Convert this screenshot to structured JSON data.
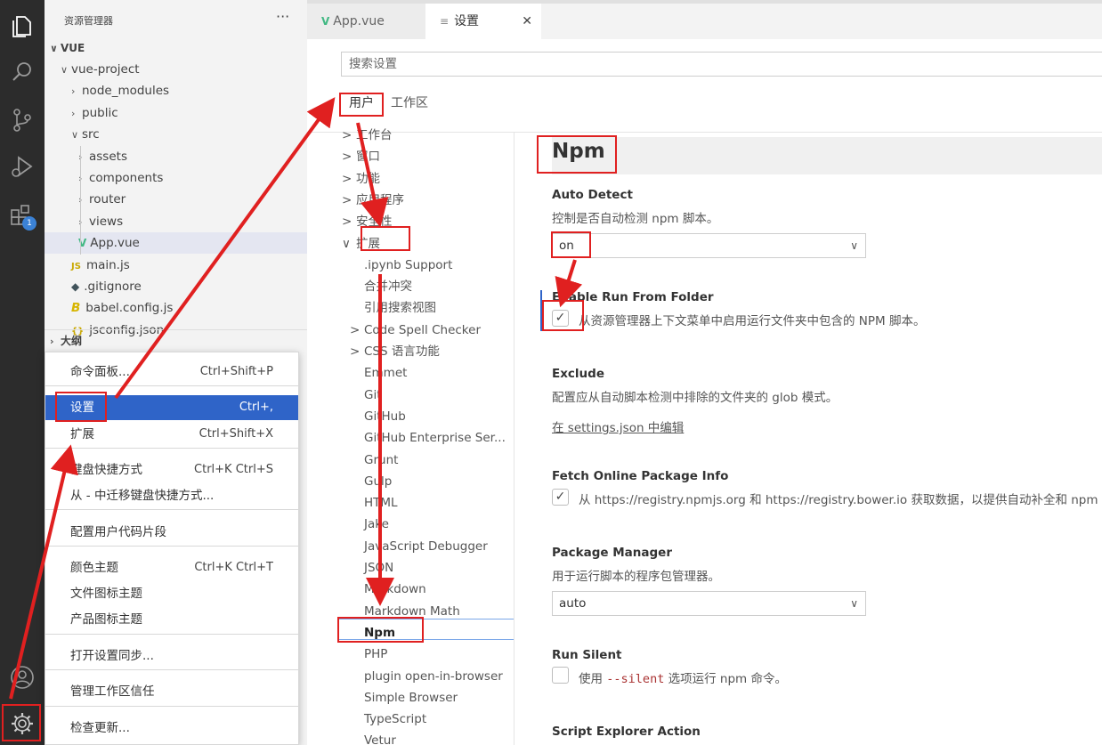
{
  "sidebar": {
    "title": "资源管理器",
    "more": "···",
    "root": "VUE",
    "tree": [
      {
        "label": "vue-project",
        "kind": "folder-open"
      },
      {
        "label": "node_modules",
        "kind": "folder"
      },
      {
        "label": "public",
        "kind": "folder"
      },
      {
        "label": "src",
        "kind": "folder-open"
      },
      {
        "label": "assets",
        "kind": "folder"
      },
      {
        "label": "components",
        "kind": "folder"
      },
      {
        "label": "router",
        "kind": "folder"
      },
      {
        "label": "views",
        "kind": "folder"
      },
      {
        "label": "App.vue",
        "kind": "vue"
      },
      {
        "label": "main.js",
        "kind": "js"
      },
      {
        "label": ".gitignore",
        "kind": "git"
      },
      {
        "label": "babel.config.js",
        "kind": "babel"
      },
      {
        "label": "jsconfig.json",
        "kind": "json"
      }
    ],
    "outline": "大纲",
    "extensions_badge": "1",
    "icons": {
      "vue": "V",
      "js": "JS",
      "git": "◆",
      "babel": "B",
      "json": "{}"
    }
  },
  "menu": {
    "items": [
      {
        "label": "命令面板...",
        "key": "Ctrl+Shift+P"
      },
      {
        "label": "设置",
        "key": "Ctrl+,"
      },
      {
        "label": "扩展",
        "key": "Ctrl+Shift+X"
      },
      {
        "label": "键盘快捷方式",
        "key": "Ctrl+K Ctrl+S"
      },
      {
        "label": "从 - 中迁移键盘快捷方式...",
        "key": ""
      },
      {
        "label": "配置用户代码片段",
        "key": ""
      },
      {
        "label": "颜色主题",
        "key": "Ctrl+K Ctrl+T"
      },
      {
        "label": "文件图标主题",
        "key": ""
      },
      {
        "label": "产品图标主题",
        "key": ""
      },
      {
        "label": "打开设置同步...",
        "key": ""
      },
      {
        "label": "管理工作区信任",
        "key": ""
      },
      {
        "label": "检查更新...",
        "key": ""
      }
    ]
  },
  "tabs": [
    {
      "label": "App.vue",
      "icon": "V"
    },
    {
      "label": "设置",
      "icon": "≡",
      "close": "✕"
    }
  ],
  "settings": {
    "search_placeholder": "搜索设置",
    "scopes": [
      "用户",
      "工作区"
    ],
    "toc": [
      {
        "label": "工作台",
        "chev": ">"
      },
      {
        "label": "窗口",
        "chev": ">"
      },
      {
        "label": "功能",
        "chev": ">"
      },
      {
        "label": "应用程序",
        "chev": ">"
      },
      {
        "label": "安全性",
        "chev": ">"
      },
      {
        "label": "扩展",
        "chev": "∨"
      },
      {
        "label": ".ipynb Support",
        "chev": ""
      },
      {
        "label": "合并冲突",
        "chev": ""
      },
      {
        "label": "引用搜索视图",
        "chev": ""
      },
      {
        "label": "Code Spell Checker",
        "chev": ">"
      },
      {
        "label": "CSS 语言功能",
        "chev": ">"
      },
      {
        "label": "Emmet",
        "chev": ""
      },
      {
        "label": "Git",
        "chev": ""
      },
      {
        "label": "GitHub",
        "chev": ""
      },
      {
        "label": "GitHub Enterprise Ser...",
        "chev": ""
      },
      {
        "label": "Grunt",
        "chev": ""
      },
      {
        "label": "Gulp",
        "chev": ""
      },
      {
        "label": "HTML",
        "chev": ""
      },
      {
        "label": "Jake",
        "chev": ""
      },
      {
        "label": "JavaScript Debugger",
        "chev": ""
      },
      {
        "label": "JSON",
        "chev": ""
      },
      {
        "label": "Markdown",
        "chev": ""
      },
      {
        "label": "Markdown Math",
        "chev": ""
      },
      {
        "label": "Npm",
        "chev": ""
      },
      {
        "label": "PHP",
        "chev": ""
      },
      {
        "label": "plugin open-in-browser",
        "chev": ""
      },
      {
        "label": "Simple Browser",
        "chev": ""
      },
      {
        "label": "TypeScript",
        "chev": ""
      },
      {
        "label": "Vetur",
        "chev": ""
      }
    ],
    "heading": "Npm",
    "auto_detect": {
      "title": "Auto Detect",
      "desc": "控制是否自动检测 npm 脚本。",
      "value": "on"
    },
    "run_from_folder": {
      "title": "Enable Run From Folder",
      "desc": "从资源管理器上下文菜单中启用运行文件夹中包含的 NPM 脚本。",
      "checked": "✓"
    },
    "exclude": {
      "title": "Exclude",
      "desc": "配置应从自动脚本检测中排除的文件夹的 glob 模式。",
      "link": "在 settings.json 中编辑"
    },
    "fetch_online": {
      "title": "Fetch Online Package Info",
      "desc": "从 https://registry.npmjs.org 和 https://registry.bower.io 获取数据，以提供自动补全和 npm 依",
      "checked": "✓"
    },
    "package_manager": {
      "title": "Package Manager",
      "desc": "用于运行脚本的程序包管理器。",
      "value": "auto"
    },
    "run_silent": {
      "title": "Run Silent",
      "desc_pre": "使用 ",
      "desc_code": "--silent",
      "desc_post": " 选项运行 npm 命令。"
    },
    "script_explorer": {
      "title": "Script Explorer Action"
    }
  }
}
